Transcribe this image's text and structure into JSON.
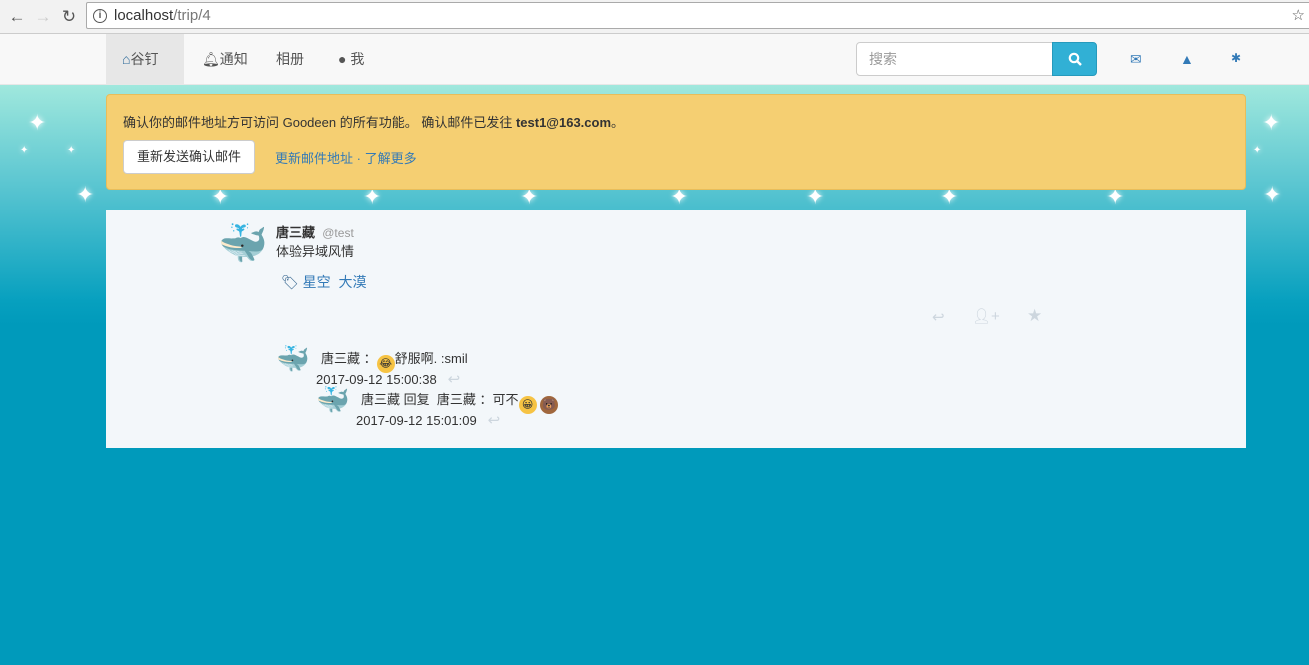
{
  "browser": {
    "url_host": "localhost",
    "url_path": "/trip/4"
  },
  "nav": {
    "items": [
      {
        "label": "谷钉",
        "icon": "home-icon"
      },
      {
        "label": "通知",
        "icon": "bell-icon"
      },
      {
        "label": "相册"
      },
      {
        "label": "我",
        "icon": "user-icon"
      }
    ],
    "search_placeholder": "搜索"
  },
  "alert": {
    "text_prefix": "确认你的邮件地址方可访问 Goodeen 的所有功能。 确认邮件已发往 ",
    "email": "test1@163.com",
    "text_suffix": "。",
    "resend_button": "重新发送确认邮件",
    "change_link": "更新邮件地址",
    "separator": " · ",
    "learn_link": "了解更多"
  },
  "post": {
    "author": "唐三藏",
    "handle": "@test",
    "content": "体验异域风情",
    "tags": [
      "星空",
      "大漠"
    ]
  },
  "comments": [
    {
      "author": "唐三藏",
      "sep": "：",
      "text": "舒服啊. :smil",
      "time": "2017-09-12 15:00:38"
    },
    {
      "author": "唐三藏",
      "reply_word": "回复",
      "reply_to": "唐三藏",
      "sep": "：",
      "text": "可不",
      "time": "2017-09-12 15:01:09"
    }
  ],
  "colors": {
    "accent": "#337ab7",
    "alert": "#f5cf72",
    "background": "#009abb"
  }
}
